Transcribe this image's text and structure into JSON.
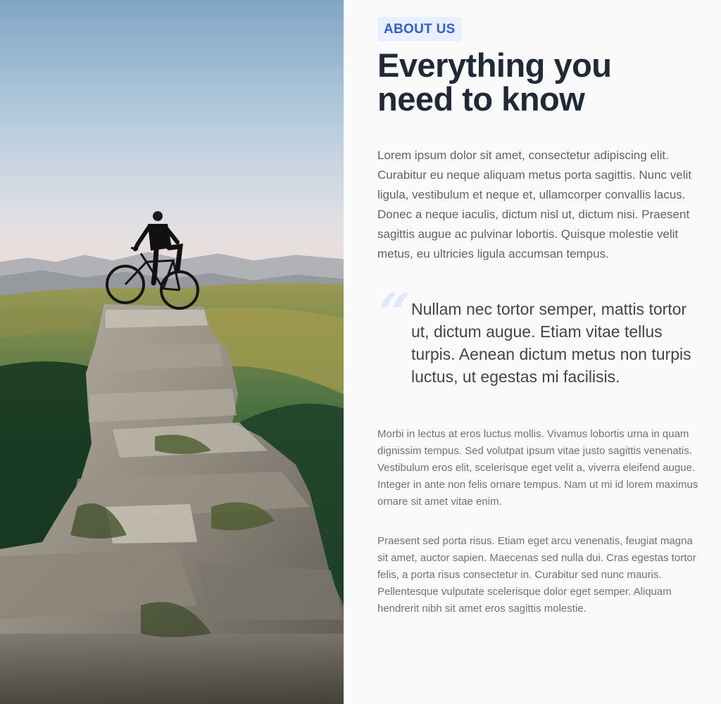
{
  "image": {
    "alt": ""
  },
  "section": {
    "eyebrow": "ABOUT US",
    "title_line_1": "Everything you",
    "title_line_2": "need to know",
    "lead": "Lorem ipsum dolor sit amet, consectetur adipiscing elit. Curabitur eu neque aliquam metus porta sagittis. Nunc velit ligula, vestibulum et neque et, ullamcorper convallis lacus. Donec a neque iaculis, dictum nisl ut, dictum nisi. Praesent sagittis augue ac pulvinar lobortis. Quisque molestie velit metus, eu ultricies ligula accumsan tempus.",
    "quote_mark": "“",
    "quote": "Nullam nec tortor semper, mattis tortor ut, dictum augue. Etiam vitae tellus turpis. Aenean dictum metus non turpis luctus, ut egestas mi facilisis.",
    "paragraph_1": "Morbi in lectus at eros luctus mollis. Vivamus lobortis urna in quam dignissim tempus. Sed volutpat ipsum vitae justo sagittis venenatis. Vestibulum eros elit, scelerisque eget velit a, viverra eleifend augue. Integer in ante non felis ornare tempus. Nam ut mi id lorem maximus ornare sit amet vitae enim.",
    "paragraph_2": "Praesent sed porta risus. Etiam eget arcu venenatis, feugiat magna sit amet, auctor sapien. Maecenas sed nulla dui. Cras egestas tortor felis, a porta risus consectetur in. Curabitur sed nunc mauris. Pellentesque vulputate scelerisque dolor eget semper. Aliquam hendrerit nibh sit amet eros sagittis molestie."
  },
  "colors": {
    "accent": "#2f5fd0",
    "accent_bg": "#e8efff",
    "heading": "#1f2937",
    "body_text": "#5b6472",
    "background": "#fafafa"
  }
}
